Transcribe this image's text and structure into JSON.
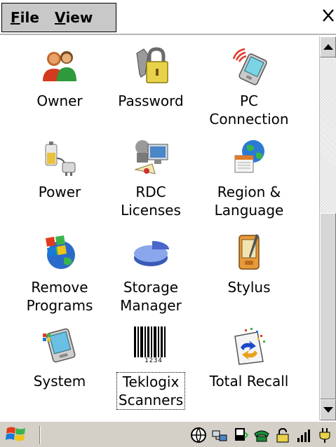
{
  "menu": {
    "file_label": "File",
    "file_key": "F",
    "file_rest": "ile",
    "view_key": "V",
    "view_rest": "iew",
    "view_label": "View"
  },
  "window": {
    "close_glyph": "✕"
  },
  "applets": [
    {
      "label_lines": [
        "Owner"
      ],
      "icon": "owner-icon"
    },
    {
      "label_lines": [
        "Password"
      ],
      "icon": "password-icon"
    },
    {
      "label_lines": [
        "PC",
        "Connection"
      ],
      "icon": "pc-connection-icon"
    },
    {
      "label_lines": [
        "Power"
      ],
      "icon": "power-icon"
    },
    {
      "label_lines": [
        "RDC",
        "Licenses"
      ],
      "icon": "rdc-licenses-icon"
    },
    {
      "label_lines": [
        "Region &",
        "Language"
      ],
      "icon": "region-language-icon"
    },
    {
      "label_lines": [
        "Remove",
        "Programs"
      ],
      "icon": "remove-programs-icon"
    },
    {
      "label_lines": [
        "Storage",
        "Manager"
      ],
      "icon": "storage-manager-icon"
    },
    {
      "label_lines": [
        "Stylus"
      ],
      "icon": "stylus-icon"
    },
    {
      "label_lines": [
        "System"
      ],
      "icon": "system-icon"
    },
    {
      "label_lines": [
        "Teklogix",
        "Scanners"
      ],
      "icon": "teklogix-scanners-icon",
      "focused": true
    },
    {
      "label_lines": [
        "Total Recall"
      ],
      "icon": "total-recall-icon"
    }
  ],
  "barcode_digits": "1234",
  "taskbar": {
    "tray_icons": [
      "globe-icon",
      "network-icon",
      "device-icon",
      "phone-icon",
      "lock-icon",
      "signal-icon",
      "power-plug-icon"
    ]
  }
}
